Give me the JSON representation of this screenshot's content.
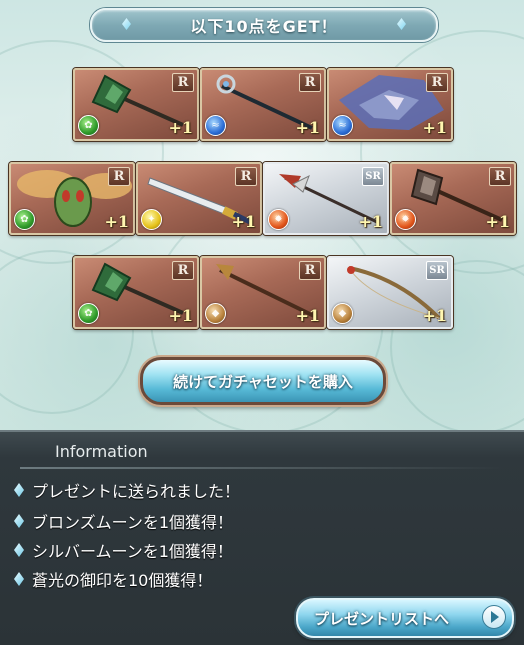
{
  "banner": {
    "title": "以下10点をGET！"
  },
  "colors": {
    "accent": "#57b9d6",
    "panel": "#2b3337",
    "card_r": "#a86a57",
    "card_sr": "#d0d6dc"
  },
  "cards": [
    {
      "rarity": "R",
      "element": "wind",
      "qty": "+1",
      "weapon": "axe-icon"
    },
    {
      "rarity": "R",
      "element": "water",
      "qty": "+1",
      "weapon": "staff-icon"
    },
    {
      "rarity": "R",
      "element": "water",
      "qty": "+1",
      "weapon": "dragon-icon"
    },
    {
      "rarity": "R",
      "element": "wind",
      "qty": "+1",
      "weapon": "insect-mask-icon"
    },
    {
      "rarity": "R",
      "element": "light",
      "qty": "+1",
      "weapon": "sword-icon"
    },
    {
      "rarity": "SR",
      "element": "fire",
      "qty": "+1",
      "weapon": "spear-icon"
    },
    {
      "rarity": "R",
      "element": "fire",
      "qty": "+1",
      "weapon": "axe-icon"
    },
    {
      "rarity": "R",
      "element": "wind",
      "qty": "+1",
      "weapon": "axe-icon"
    },
    {
      "rarity": "R",
      "element": "earth",
      "qty": "+1",
      "weapon": "staff-icon"
    },
    {
      "rarity": "SR",
      "element": "earth",
      "qty": "+1",
      "weapon": "bow-icon"
    }
  ],
  "buttons": {
    "buy_again": "続けてガチャセットを購入",
    "present_list": "プレゼントリストへ"
  },
  "info": {
    "title": "Information",
    "items": [
      "プレゼントに送られました！",
      "ブロンズムーンを1個獲得！",
      "シルバームーンを1個獲得！",
      "蒼光の御印を10個獲得！"
    ]
  }
}
